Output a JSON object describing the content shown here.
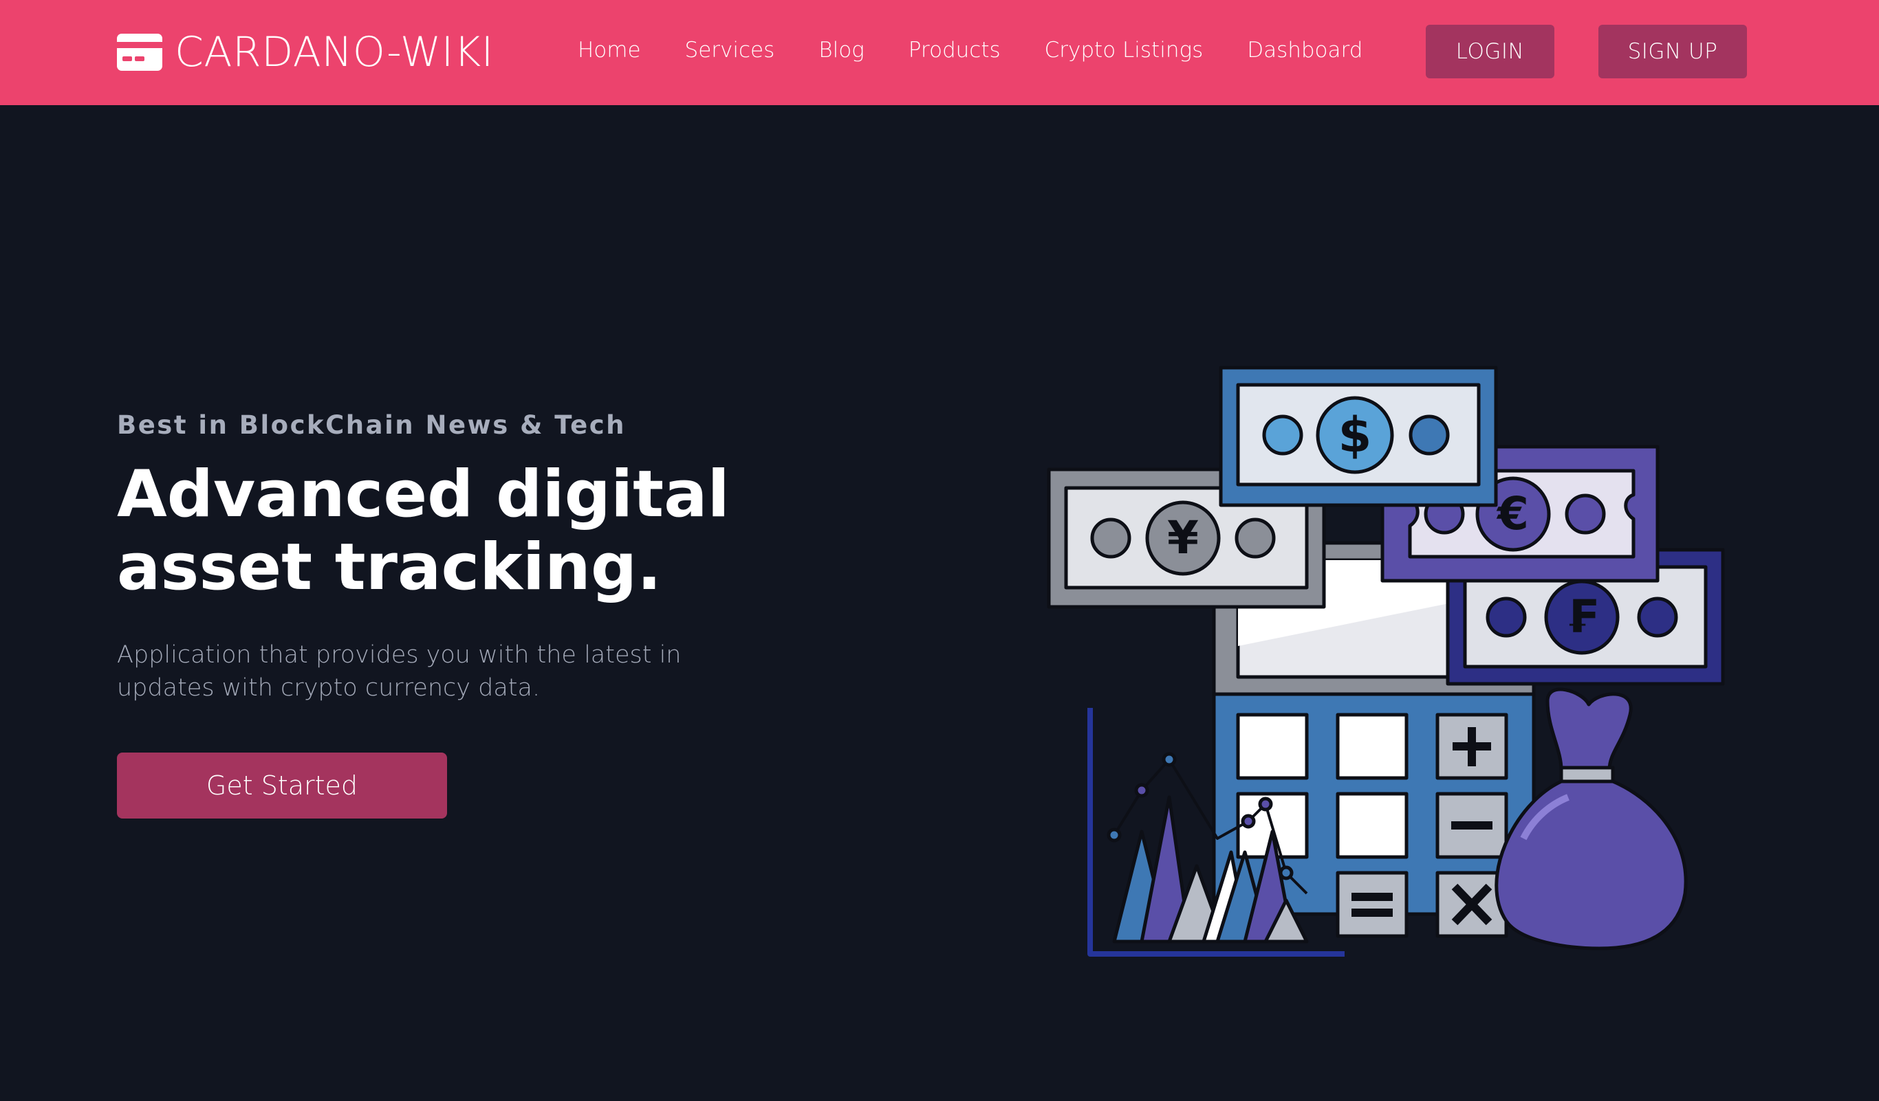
{
  "brand": {
    "name": "CARDANO-WIKI",
    "icon": "credit-card-icon"
  },
  "nav": {
    "links": [
      "Home",
      "Services",
      "Blog",
      "Products",
      "Crypto Listings",
      "Dashboard"
    ],
    "login_label": "LOGIN",
    "signup_label": "SIGN UP"
  },
  "hero": {
    "eyebrow": "Best in BlockChain News & Tech",
    "headline_line1": "Advanced digital",
    "headline_line2": "asset tracking.",
    "description": "Application that provides you with the latest in updates with crypto currency data.",
    "cta_label": "Get Started"
  },
  "illustration": {
    "subject": "money-calculator-illustration",
    "currency_symbols": [
      "$",
      "¥",
      "€",
      "₣"
    ]
  },
  "colors": {
    "navbar": "#ec436d",
    "background": "#111520",
    "button": "#a4345e",
    "eyebrow_text": "#a7adbc"
  }
}
